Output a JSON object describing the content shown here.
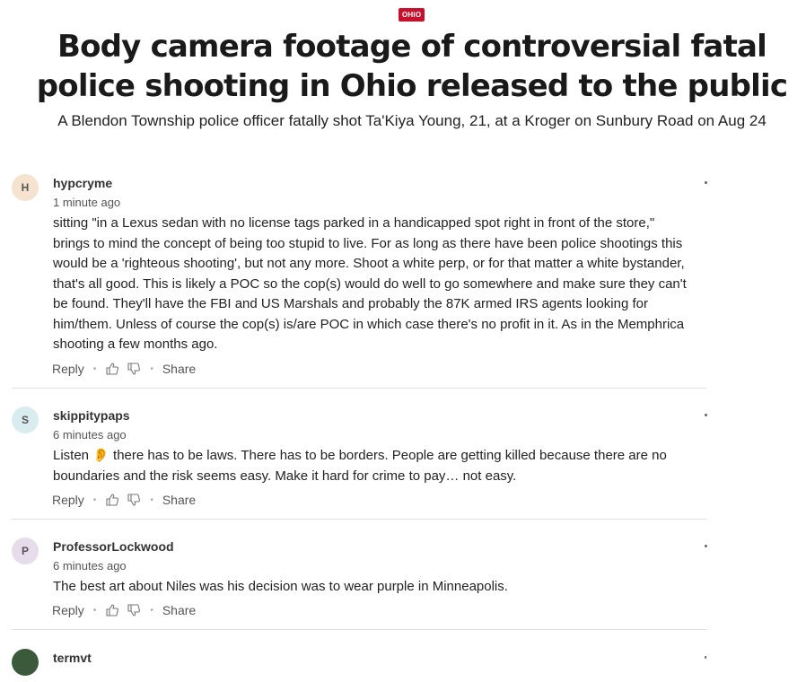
{
  "article": {
    "tag": "OHIO",
    "headline": "Body camera footage of controversial fatal police shooting in Ohio released to the public",
    "subhead": "A Blendon Township police officer fatally shot Ta'Kiya Young, 21, at a Kroger on Sunbury Road on Aug 24"
  },
  "comments": [
    {
      "initial": "H",
      "avatar_color": "#f5e3cf",
      "username": "hypcryme",
      "time": "1 minute ago",
      "text": "sitting \"in a Lexus sedan with no license tags parked in a handicapped spot right in front of the store,\" brings to mind the concept of being too stupid to live.  For as long as there have been police shootings this would be a 'righteous shooting', but not any more.  Shoot a white perp, or for that matter a white bystander, that's all good.  This is likely a POC so the cop(s) would do well to go somewhere and make sure they can't be found.  They'll have the FBI and US Marshals and probably the 87K armed IRS agents looking for him/them.  Unless of course the cop(s) is/are POC in which case there's no profit in it.  As in the Memphrica shooting a few months ago.",
      "reply": "Reply",
      "share": "Share"
    },
    {
      "initial": "S",
      "avatar_color": "#d9ecef",
      "username": "skippitypaps",
      "time": "6 minutes ago",
      "text": "Listen 👂 there has to be laws. There has to be borders. People are getting killed because there are no boundaries and the risk seems easy. Make it hard for crime to pay… not easy.",
      "reply": "Reply",
      "share": "Share"
    },
    {
      "initial": "P",
      "avatar_color": "#e6dcec",
      "username": "ProfessorLockwood",
      "time": "6 minutes ago",
      "text": "The best art about Niles was his decision was to wear purple in Minneapolis.",
      "reply": "Reply",
      "share": "Share"
    },
    {
      "initial": "",
      "avatar_color": "#3b5a3b",
      "username": "termvt"
    }
  ]
}
